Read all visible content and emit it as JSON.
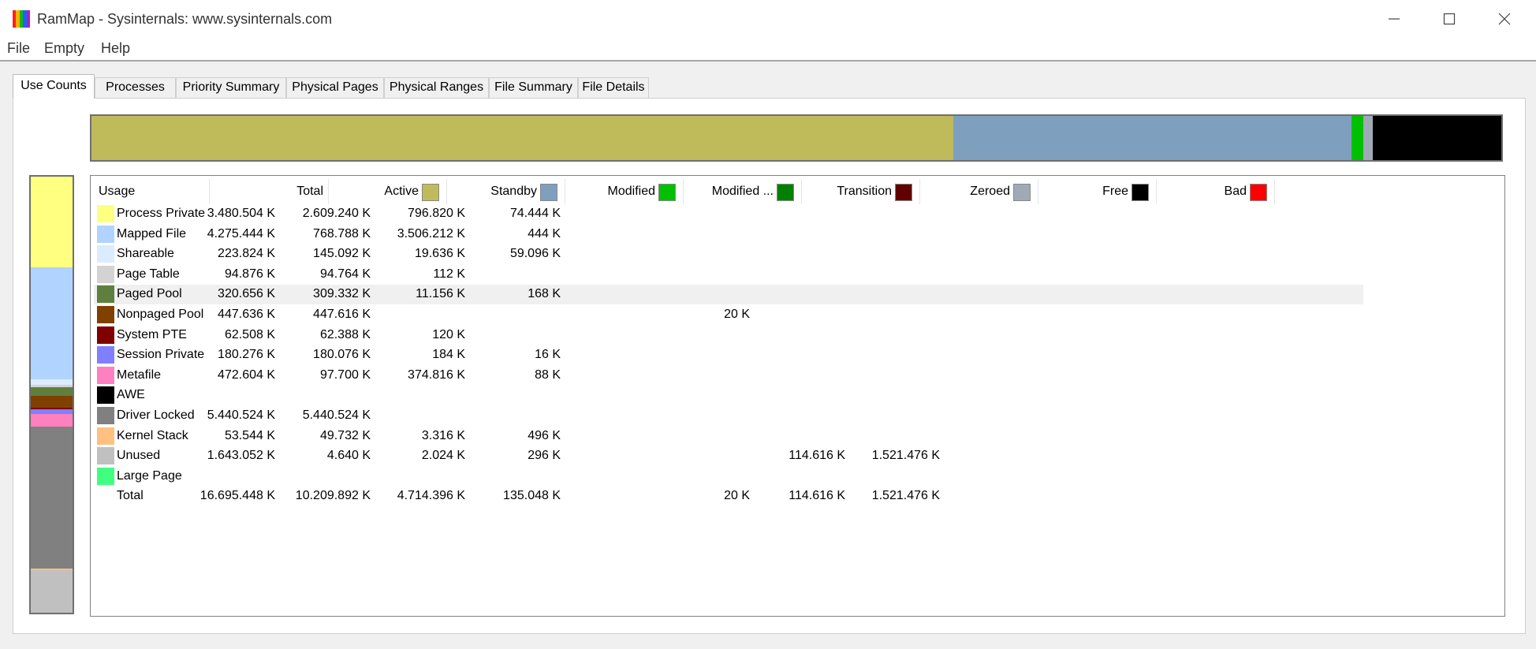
{
  "window": {
    "title": "RamMap - Sysinternals: www.sysinternals.com",
    "icon": "rammap-icon",
    "icon_colors": [
      "#ff1f1f",
      "#ffb000",
      "#16b516",
      "#2060ff",
      "#b020b0"
    ]
  },
  "menu": [
    "File",
    "Empty",
    "Help"
  ],
  "tabs": [
    "Use Counts",
    "Processes",
    "Priority Summary",
    "Physical Pages",
    "Physical Ranges",
    "File Summary",
    "File Details"
  ],
  "active_tab": "Use Counts",
  "colors": {
    "active": "#bfbb5b",
    "standby": "#7f9fbf",
    "modified": "#00c000",
    "modified_no_write": "#008000",
    "transition": "#600000",
    "zeroed": "#a0aab7",
    "free": "#000000",
    "bad": "#ff0000"
  },
  "columns": [
    {
      "label": "Usage",
      "swatch": null
    },
    {
      "label": "Total",
      "swatch": null
    },
    {
      "label": "Active",
      "swatch": "#bfbb5b"
    },
    {
      "label": "Standby",
      "swatch": "#7f9fbf"
    },
    {
      "label": "Modified",
      "swatch": "#00c000"
    },
    {
      "label": "Modified ...",
      "swatch": "#008000"
    },
    {
      "label": "Transition",
      "swatch": "#600000"
    },
    {
      "label": "Zeroed",
      "swatch": "#a0aab7"
    },
    {
      "label": "Free",
      "swatch": "#000000"
    },
    {
      "label": "Bad",
      "swatch": "#ff0000"
    }
  ],
  "rows": [
    {
      "name": "Process Private",
      "color": "#ffff80",
      "cells": [
        "3.480.504 K",
        "2.609.240 K",
        "796.820 K",
        "74.444 K",
        "",
        "",
        "",
        "",
        ""
      ]
    },
    {
      "name": "Mapped File",
      "color": "#b0d4ff",
      "cells": [
        "4.275.444 K",
        "768.788 K",
        "3.506.212 K",
        "444 K",
        "",
        "",
        "",
        "",
        ""
      ]
    },
    {
      "name": "Shareable",
      "color": "#dcecff",
      "cells": [
        "223.824 K",
        "145.092 K",
        "19.636 K",
        "59.096 K",
        "",
        "",
        "",
        "",
        ""
      ]
    },
    {
      "name": "Page Table",
      "color": "#d3d3d3",
      "cells": [
        "94.876 K",
        "94.764 K",
        "112 K",
        "",
        "",
        "",
        "",
        "",
        ""
      ]
    },
    {
      "name": "Paged Pool",
      "color": "#5f7f3f",
      "cells": [
        "320.656 K",
        "309.332 K",
        "11.156 K",
        "168 K",
        "",
        "",
        "",
        "",
        ""
      ],
      "selected": true
    },
    {
      "name": "Nonpaged Pool",
      "color": "#804000",
      "cells": [
        "447.636 K",
        "447.616 K",
        "",
        "",
        "",
        "20 K",
        "",
        "",
        ""
      ]
    },
    {
      "name": "System PTE",
      "color": "#800000",
      "cells": [
        "62.508 K",
        "62.388 K",
        "120 K",
        "",
        "",
        "",
        "",
        "",
        ""
      ]
    },
    {
      "name": "Session Private",
      "color": "#8080ff",
      "cells": [
        "180.276 K",
        "180.076 K",
        "184 K",
        "16 K",
        "",
        "",
        "",
        "",
        ""
      ]
    },
    {
      "name": "Metafile",
      "color": "#ff80c0",
      "cells": [
        "472.604 K",
        "97.700 K",
        "374.816 K",
        "88 K",
        "",
        "",
        "",
        "",
        ""
      ]
    },
    {
      "name": "AWE",
      "color": "#000000",
      "cells": [
        "",
        "",
        "",
        "",
        "",
        "",
        "",
        "",
        ""
      ]
    },
    {
      "name": "Driver Locked",
      "color": "#808080",
      "cells": [
        "5.440.524 K",
        "5.440.524 K",
        "",
        "",
        "",
        "",
        "",
        "",
        ""
      ]
    },
    {
      "name": "Kernel Stack",
      "color": "#ffc080",
      "cells": [
        "53.544 K",
        "49.732 K",
        "3.316 K",
        "496 K",
        "",
        "",
        "",
        "",
        ""
      ]
    },
    {
      "name": "Unused",
      "color": "#c0c0c0",
      "cells": [
        "1.643.052 K",
        "4.640 K",
        "2.024 K",
        "296 K",
        "",
        "",
        "114.616 K",
        "1.521.476 K",
        ""
      ]
    },
    {
      "name": "Large Page",
      "color": "#40ff80",
      "cells": [
        "",
        "",
        "",
        "",
        "",
        "",
        "",
        "",
        ""
      ]
    },
    {
      "name": "Total",
      "color": null,
      "cells": [
        "16.695.448 K",
        "10.209.892 K",
        "4.714.396 K",
        "135.048 K",
        "",
        "20 K",
        "114.616 K",
        "1.521.476 K",
        ""
      ]
    }
  ],
  "state_bar": [
    {
      "state": "Active",
      "value_k": 10209892,
      "color": "#bfbb5b"
    },
    {
      "state": "Standby",
      "value_k": 4714396,
      "color": "#7f9fbf"
    },
    {
      "state": "Modified",
      "value_k": 135048,
      "color": "#00c000"
    },
    {
      "state": "Transition",
      "value_k": 20,
      "color": "#600000"
    },
    {
      "state": "Zeroed",
      "value_k": 114616,
      "color": "#a0aab7"
    },
    {
      "state": "Free",
      "value_k": 1521476,
      "color": "#000000"
    }
  ],
  "usage_bar": [
    {
      "usage": "Process Private",
      "value_k": 3480504,
      "color": "#ffff80"
    },
    {
      "usage": "Mapped File",
      "value_k": 4275444,
      "color": "#b0d4ff"
    },
    {
      "usage": "Shareable",
      "value_k": 223824,
      "color": "#dcecff"
    },
    {
      "usage": "Page Table",
      "value_k": 94876,
      "color": "#d3d3d3"
    },
    {
      "usage": "Paged Pool",
      "value_k": 320656,
      "color": "#5f7f3f"
    },
    {
      "usage": "Nonpaged Pool",
      "value_k": 447636,
      "color": "#804000"
    },
    {
      "usage": "System PTE",
      "value_k": 62508,
      "color": "#800000"
    },
    {
      "usage": "Session Private",
      "value_k": 180276,
      "color": "#8080ff"
    },
    {
      "usage": "Metafile",
      "value_k": 472604,
      "color": "#ff80c0"
    },
    {
      "usage": "Driver Locked",
      "value_k": 5440524,
      "color": "#808080"
    },
    {
      "usage": "Kernel Stack",
      "value_k": 53544,
      "color": "#ffc080"
    },
    {
      "usage": "Unused",
      "value_k": 1643052,
      "color": "#c0c0c0"
    }
  ]
}
